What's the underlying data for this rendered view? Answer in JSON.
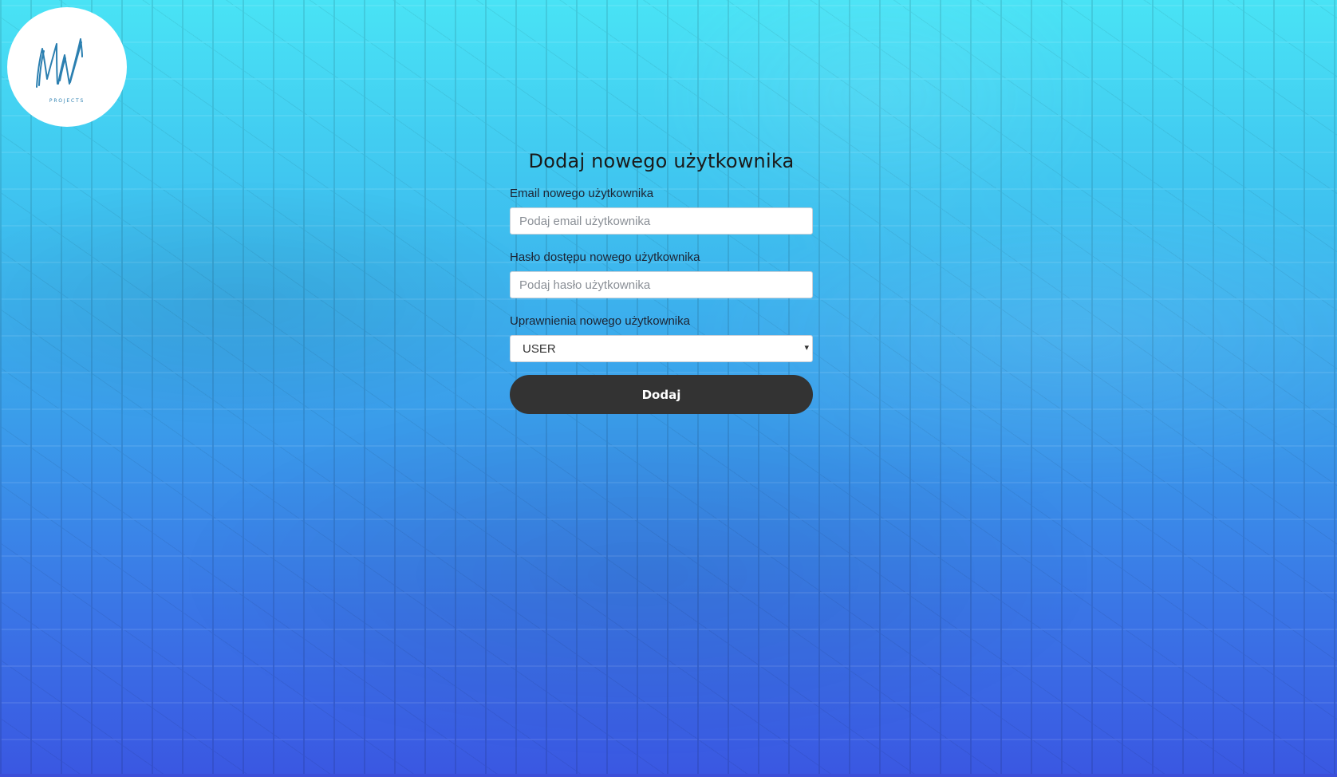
{
  "logo": {
    "text": "MW",
    "subtext": "PROJECTS"
  },
  "form": {
    "title": "Dodaj nowego użytkownika",
    "email": {
      "label": "Email nowego użytkownika",
      "placeholder": "Podaj email użytkownika",
      "value": ""
    },
    "password": {
      "label": "Hasło dostępu nowego użytkownika",
      "placeholder": "Podaj hasło użytkownika",
      "value": ""
    },
    "role": {
      "label": "Uprawnienia nowego użytkownika",
      "selected": "USER",
      "caret_icon": "▾"
    },
    "submit_label": "Dodaj"
  },
  "colors": {
    "gradient_top": "#49e3f5",
    "gradient_bottom": "#3a57e2",
    "button_bg": "#333333",
    "button_text": "#ffffff"
  }
}
